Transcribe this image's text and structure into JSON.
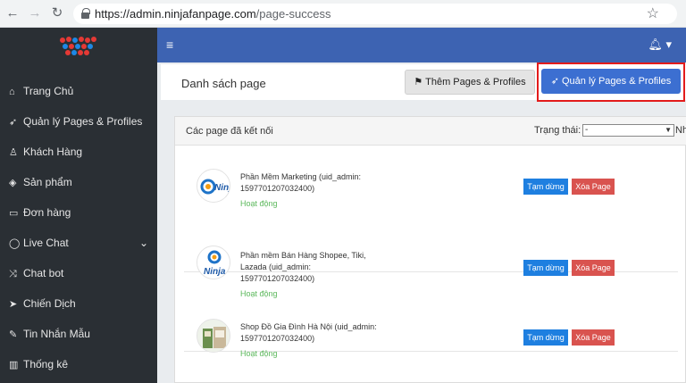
{
  "browser": {
    "url_host": "https://admin.ninjafanpage.com",
    "url_path": "/page-success"
  },
  "sidebar": {
    "items": [
      {
        "label": "Trang Chủ",
        "icon": "home-icon"
      },
      {
        "label": "Quản lý Pages & Profiles",
        "icon": "rocket-icon"
      },
      {
        "label": "Khách Hàng",
        "icon": "user-icon"
      },
      {
        "label": "Sản phẩm",
        "icon": "cube-icon"
      },
      {
        "label": "Đơn hàng",
        "icon": "card-icon"
      },
      {
        "label": "Live Chat",
        "icon": "chat-icon"
      },
      {
        "label": "Chat bot",
        "icon": "random-icon"
      },
      {
        "label": "Chiến Dịch",
        "icon": "paper-plane-icon"
      },
      {
        "label": "Tin Nhắn Mẫu",
        "icon": "tag-icon"
      },
      {
        "label": "Thống kê",
        "icon": "bar-chart-icon"
      }
    ]
  },
  "header": {
    "title": "Danh sách page",
    "add_button": "Thêm Pages & Profiles",
    "manage_button": "Quản lý Pages & Profiles"
  },
  "list": {
    "title": "Các page đã kết nối",
    "status_label": "Trạng thái:",
    "status_value": "-",
    "status_suffix": "Nh",
    "pause_label": "Tạm dừng",
    "delete_label": "Xóa Page",
    "pages": [
      {
        "name": "Phần Mềm Marketing (uid_admin: 1597701207032400)",
        "status": "Hoạt động"
      },
      {
        "name": "Phần mềm Bán Hàng Shopee, Tiki, Lazada (uid_admin: 1597701207032400)",
        "status": "Hoạt động"
      },
      {
        "name": "Shop Đồ Gia Đình Hà Nội (uid_admin: 1597701207032400)",
        "status": "Hoạt động"
      }
    ]
  },
  "colors": {
    "topbar": "#3d63b2",
    "sidebar": "#2a2f34",
    "primary_button": "#3c6fd1",
    "highlight_border": "#e31b1b",
    "pause_button": "#1e7fe0",
    "delete_button": "#d9534f",
    "active_status": "#5cb85c"
  }
}
